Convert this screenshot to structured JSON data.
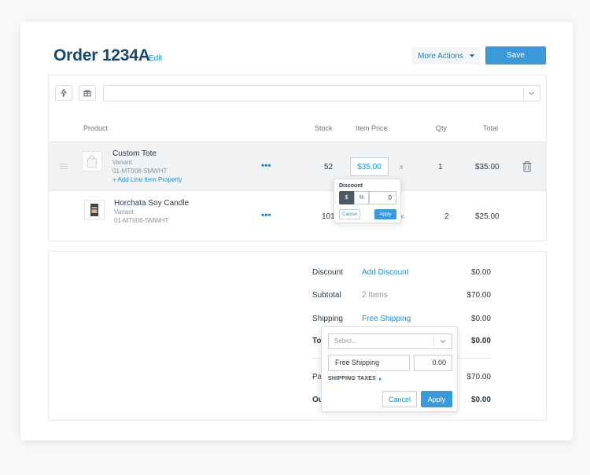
{
  "header": {
    "title": "Order 1234A",
    "edit_label": "Edit",
    "more_actions_label": "More Actions",
    "save_label": "Save"
  },
  "search": {
    "placeholder": ""
  },
  "columns": {
    "product": "Product",
    "stock": "Stock",
    "item_price": "Item Price",
    "qty": "Qty",
    "total": "Total"
  },
  "line_items": [
    {
      "name": "Custom Tote",
      "variant": "Variant",
      "sku": "01-MT008-SMWHT",
      "add_property": "+ Add Line Item Property",
      "stock": "52",
      "price": "$35.00",
      "times": "x",
      "qty": "1",
      "total": "$35.00"
    },
    {
      "name": "Horchata Soy Candle",
      "variant": "Variant",
      "sku": "01-MT008-SMWHT",
      "stock": "101",
      "times": "x",
      "qty": "2",
      "total": "$25.00"
    }
  ],
  "discount_popover": {
    "label": "Discount",
    "dollar": "$",
    "percent": "%",
    "value": "0",
    "cancel": "Cancel",
    "apply": "Apply"
  },
  "summary": {
    "discount_label": "Discount",
    "discount_action": "Add Discount",
    "discount_value": "$0.00",
    "subtotal_label": "Subtotal",
    "subtotal_items": "2 Items",
    "subtotal_value": "$70.00",
    "shipping_label": "Shipping",
    "shipping_action": "Free Shipping",
    "shipping_value": "$0.00",
    "total_label_partial": "To",
    "total_value": "$0.00",
    "paid_label_partial": "Pai",
    "paid_value": "$70.00",
    "outstanding_label_partial": "Ou",
    "outstanding_value": "$0.00"
  },
  "shipping_popover": {
    "select_placeholder": "Select...",
    "name": "Free Shipping",
    "amount": "0.00",
    "taxes_label": "SHIPPING TAXES",
    "cancel": "Cancel",
    "apply": "Apply"
  },
  "colors": {
    "accent": "#3a99d8",
    "link": "#1b8fd1",
    "title": "#16466e"
  }
}
